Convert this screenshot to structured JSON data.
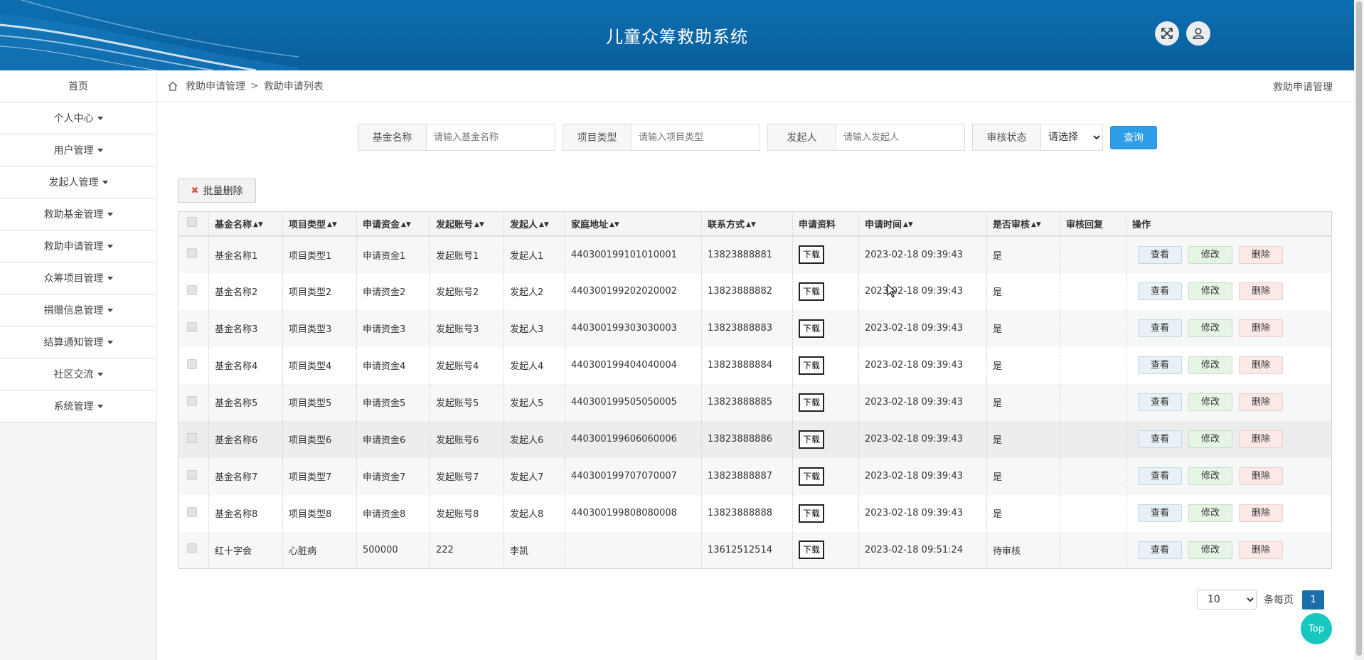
{
  "header": {
    "title": "儿童众筹救助系统",
    "icons": [
      "fullscreen-icon",
      "user-icon"
    ],
    "colors": {
      "bg": "#0a5e9c",
      "accent": "#2e9ee8"
    }
  },
  "sidebar": {
    "items": [
      {
        "label": "首页",
        "has_caret": false
      },
      {
        "label": "个人中心",
        "has_caret": true
      },
      {
        "label": "用户管理",
        "has_caret": true
      },
      {
        "label": "发起人管理",
        "has_caret": true
      },
      {
        "label": "救助基金管理",
        "has_caret": true
      },
      {
        "label": "救助申请管理",
        "has_caret": true
      },
      {
        "label": "众筹项目管理",
        "has_caret": true
      },
      {
        "label": "捐赠信息管理",
        "has_caret": true
      },
      {
        "label": "结算通知管理",
        "has_caret": true
      },
      {
        "label": "社区交流",
        "has_caret": true
      },
      {
        "label": "系统管理",
        "has_caret": true
      }
    ]
  },
  "breadcrumb": {
    "items": [
      "救助申请管理",
      "救助申请列表"
    ],
    "separator": ">",
    "right_title": "救助申请管理"
  },
  "search": {
    "fund_name": {
      "label": "基金名称",
      "placeholder": "请输入基金名称",
      "value": ""
    },
    "project_type": {
      "label": "项目类型",
      "placeholder": "请输入项目类型",
      "value": ""
    },
    "initiator": {
      "label": "发起人",
      "placeholder": "请输入发起人",
      "value": ""
    },
    "review_status": {
      "label": "审核状态",
      "selected": "请选择"
    },
    "query_label": "查询"
  },
  "toolbar": {
    "batch_delete_label": "批量删除"
  },
  "table": {
    "columns": [
      "基金名称",
      "项目类型",
      "申请资金",
      "发起账号",
      "发起人",
      "家庭地址",
      "联系方式",
      "申请资料",
      "申请时间",
      "是否审核",
      "审核回复",
      "操作"
    ],
    "sortable": [
      true,
      true,
      true,
      true,
      true,
      true,
      true,
      false,
      true,
      true,
      false,
      false
    ],
    "download_label": "下载",
    "actions": {
      "view": "查看",
      "edit": "修改",
      "delete": "删除"
    },
    "rows": [
      {
        "fund": "基金名称1",
        "type": "项目类型1",
        "amount": "申请资金1",
        "account": "发起账号1",
        "initiator": "发起人1",
        "address": "440300199101010001",
        "phone": "13823888881",
        "time": "2023-02-18 09:39:43",
        "reviewed": "是",
        "reply": ""
      },
      {
        "fund": "基金名称2",
        "type": "项目类型2",
        "amount": "申请资金2",
        "account": "发起账号2",
        "initiator": "发起人2",
        "address": "440300199202020002",
        "phone": "13823888882",
        "time": "2023-02-18 09:39:43",
        "reviewed": "是",
        "reply": ""
      },
      {
        "fund": "基金名称3",
        "type": "项目类型3",
        "amount": "申请资金3",
        "account": "发起账号3",
        "initiator": "发起人3",
        "address": "440300199303030003",
        "phone": "13823888883",
        "time": "2023-02-18 09:39:43",
        "reviewed": "是",
        "reply": ""
      },
      {
        "fund": "基金名称4",
        "type": "项目类型4",
        "amount": "申请资金4",
        "account": "发起账号4",
        "initiator": "发起人4",
        "address": "440300199404040004",
        "phone": "13823888884",
        "time": "2023-02-18 09:39:43",
        "reviewed": "是",
        "reply": ""
      },
      {
        "fund": "基金名称5",
        "type": "项目类型5",
        "amount": "申请资金5",
        "account": "发起账号5",
        "initiator": "发起人5",
        "address": "440300199505050005",
        "phone": "13823888885",
        "time": "2023-02-18 09:39:43",
        "reviewed": "是",
        "reply": ""
      },
      {
        "fund": "基金名称6",
        "type": "项目类型6",
        "amount": "申请资金6",
        "account": "发起账号6",
        "initiator": "发起人6",
        "address": "440300199606060006",
        "phone": "13823888886",
        "time": "2023-02-18 09:39:43",
        "reviewed": "是",
        "reply": ""
      },
      {
        "fund": "基金名称7",
        "type": "项目类型7",
        "amount": "申请资金7",
        "account": "发起账号7",
        "initiator": "发起人7",
        "address": "440300199707070007",
        "phone": "13823888887",
        "time": "2023-02-18 09:39:43",
        "reviewed": "是",
        "reply": ""
      },
      {
        "fund": "基金名称8",
        "type": "项目类型8",
        "amount": "申请资金8",
        "account": "发起账号8",
        "initiator": "发起人8",
        "address": "440300199808080008",
        "phone": "13823888888",
        "time": "2023-02-18 09:39:43",
        "reviewed": "是",
        "reply": ""
      },
      {
        "fund": "红十字会",
        "type": "心脏病",
        "amount": "500000",
        "account": "222",
        "initiator": "李凯",
        "address": "",
        "phone": "13612512514",
        "time": "2023-02-18 09:51:24",
        "reviewed": "待审核",
        "reply": ""
      }
    ]
  },
  "pagination": {
    "page_size": "10",
    "per_page_label": "条每页",
    "current_page": "1"
  },
  "top_button": "Top"
}
